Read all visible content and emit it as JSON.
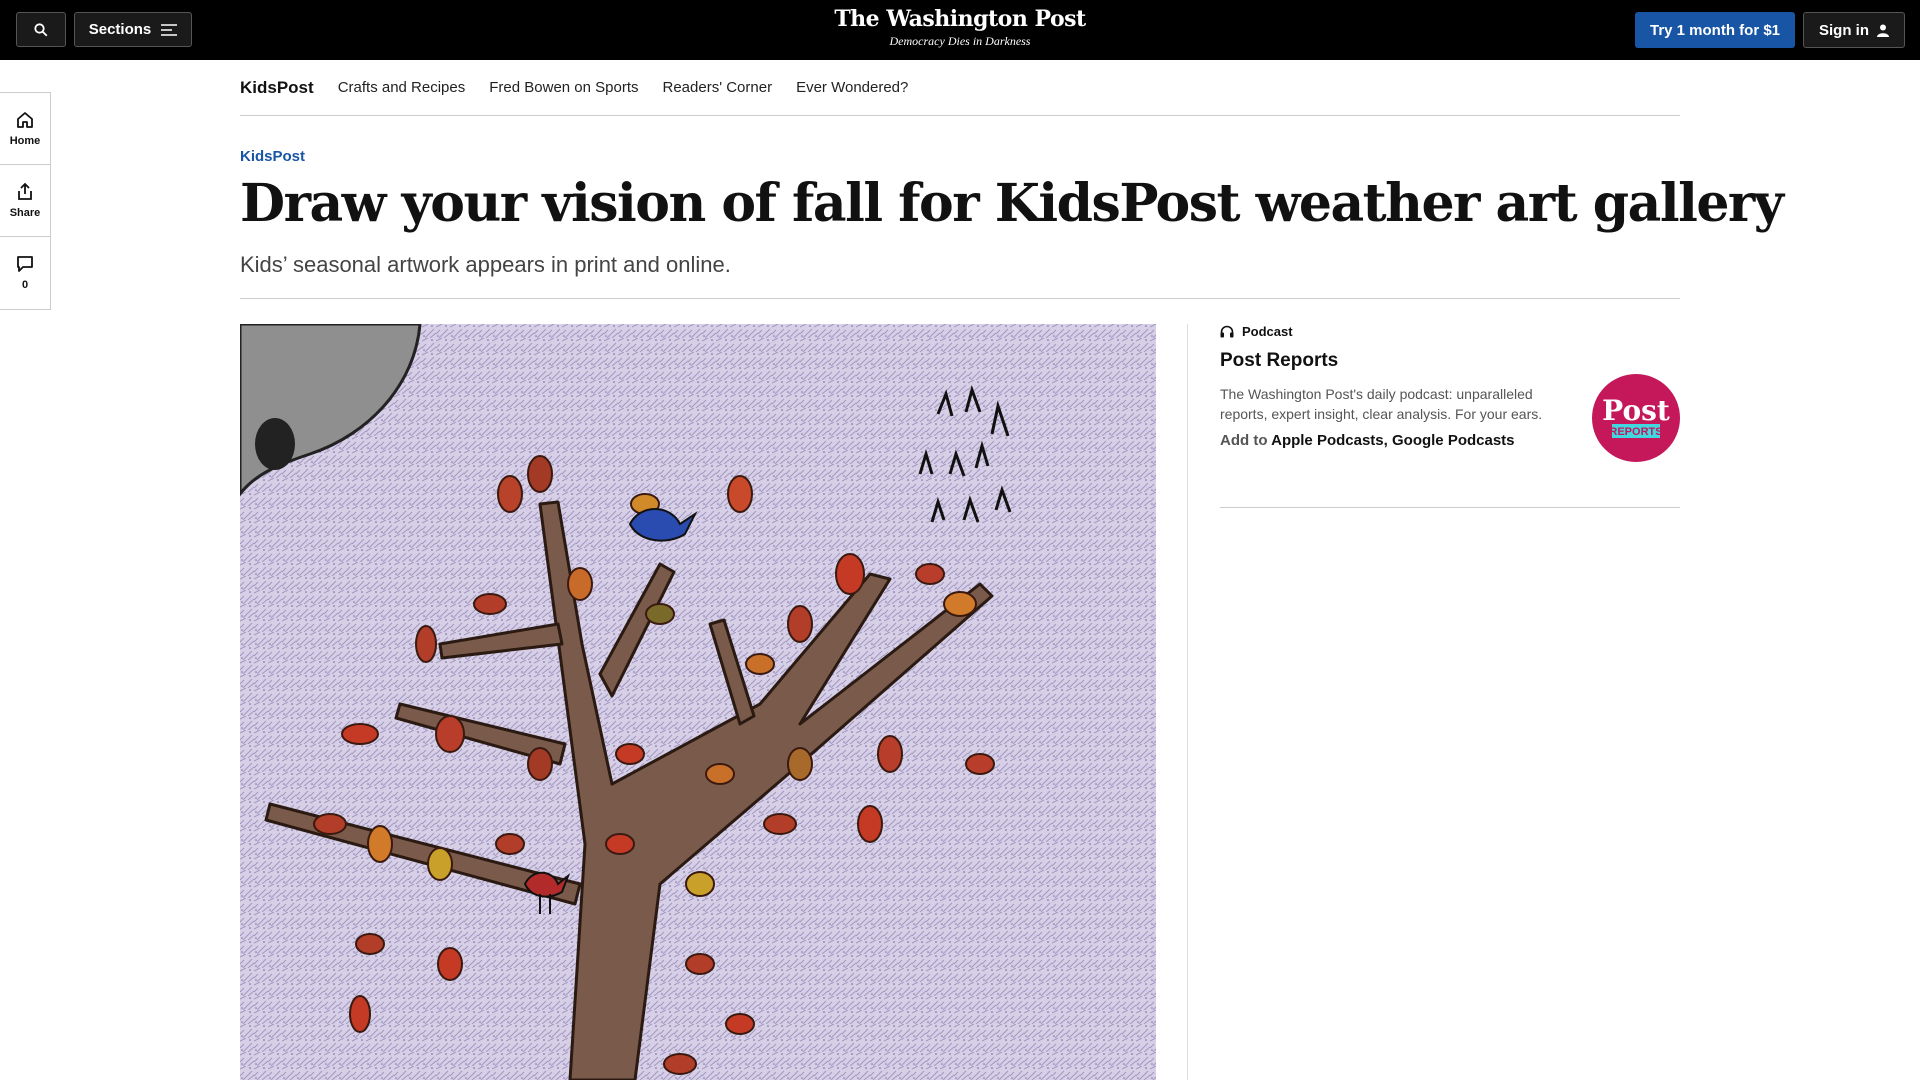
{
  "topbar": {
    "sections_label": "Sections",
    "logo": "The Washington Post",
    "tagline": "Democracy Dies in Darkness",
    "try_label": "Try 1 month for $1",
    "signin_label": "Sign in",
    "accent": "#1955a5"
  },
  "subnav": {
    "brand": "KidsPost",
    "items": [
      "Crafts and Recipes",
      "Fred Bowen on Sports",
      "Readers' Corner",
      "Ever Wondered?"
    ]
  },
  "rail": {
    "home": "Home",
    "share": "Share",
    "comments": "0"
  },
  "article": {
    "kicker": "KidsPost",
    "headline": "Draw your vision of fall for KidsPost weather art gallery",
    "dek": "Kids’ seasonal artwork appears in print and online."
  },
  "podcast": {
    "label": "Podcast",
    "title": "Post Reports",
    "description": "The Washington Post's daily podcast: unparalleled reports, expert insight, clear analysis. For your ears.",
    "add_to": "Add to",
    "apple": "Apple Podcasts",
    "separator": ",",
    "google": "Google Podcasts",
    "logo_word": "Post",
    "logo_sub": "REPORTS"
  }
}
